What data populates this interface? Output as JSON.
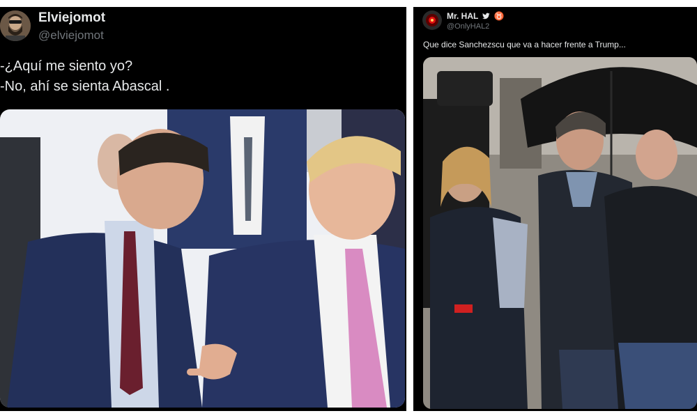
{
  "left_tweet": {
    "display_name": "Elviejomot",
    "handle": "@elviejomot",
    "text_line1": "-¿Aquí me siento yo?",
    "text_line2": "-No, ahí se sienta Abascal .",
    "avatar_icon": "bearded-man-avatar-icon",
    "media_icon": "meeting-photo-icon"
  },
  "right_tweet": {
    "display_name": "Mr. HAL",
    "verified_icon": "bird-icon",
    "zodiac_symbol": "♉",
    "handle": "@OnlyHAL2",
    "text": "Que dice Sanchezscu que va a hacer frente a Trump...",
    "avatar_icon": "hal-red-eye-avatar-icon",
    "media_icon": "crowd-umbrella-photo-icon"
  },
  "colors": {
    "background": "#000000",
    "primary_text": "#e7e9ea",
    "secondary_text": "#71767b",
    "suit_navy": "#23305a",
    "tie_pink": "#d98bc2"
  }
}
